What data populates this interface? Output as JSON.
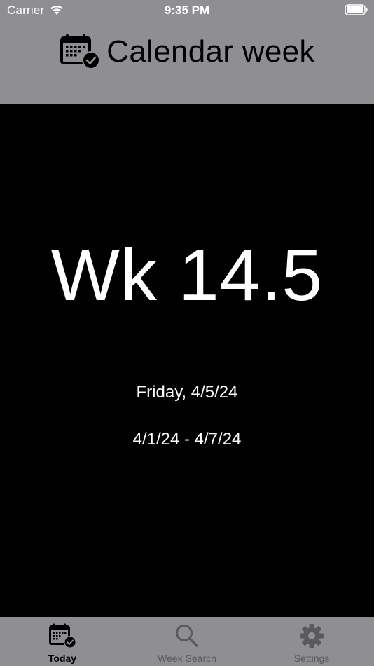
{
  "status_bar": {
    "carrier": "Carrier",
    "time": "9:35 PM"
  },
  "header": {
    "title": "Calendar week",
    "icon": "calendar-check-icon"
  },
  "main": {
    "week_number": "Wk 14.5",
    "today_date": "Friday, 4/5/24",
    "week_range": "4/1/24 - 4/7/24"
  },
  "tabs": [
    {
      "label": "Today",
      "icon": "calendar-check-icon",
      "active": true
    },
    {
      "label": "Week Search",
      "icon": "search-icon",
      "active": false
    },
    {
      "label": "Settings",
      "icon": "gear-icon",
      "active": false
    }
  ],
  "colors": {
    "header_bg": "#8e8e93",
    "main_bg": "#000000",
    "text_primary": "#ffffff",
    "tab_inactive": "#5a5a5e"
  }
}
